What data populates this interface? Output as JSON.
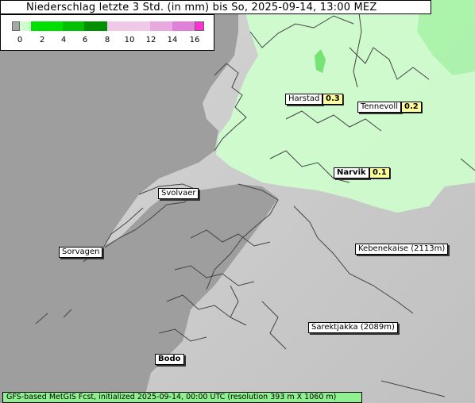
{
  "title": "Niederschlag letzte 3 Std. (in mm) bis So, 2025-09-14, 13:00 MEZ",
  "legend": {
    "ticks": [
      "0",
      "2",
      "4",
      "6",
      "8",
      "10",
      "12",
      "14",
      "16"
    ],
    "colors": [
      "#a8a8a8",
      "#cfffcf",
      "#00e000",
      "#00c000",
      "#009000",
      "#f0c8e8",
      "#e8a8e0",
      "#e080d8",
      "#ff30d0"
    ]
  },
  "places": [
    {
      "name": "Harstad",
      "bold": false
    },
    {
      "name": "Tennevoll",
      "bold": false
    },
    {
      "name": "Narvik",
      "bold": true
    },
    {
      "name": "Svolvaer",
      "bold": false
    },
    {
      "name": "Sorvagen",
      "bold": false
    },
    {
      "name": "Kebenekaise (2113m)",
      "bold": false
    },
    {
      "name": "Sarektjakka (2089m)",
      "bold": false
    },
    {
      "name": "Bodo",
      "bold": true
    }
  ],
  "values": [
    {
      "label": "0.3"
    },
    {
      "label": "0.2"
    },
    {
      "label": "0.1"
    }
  ],
  "footer": "GFS-based MetGIS Fcst, initialized 2025-09-14, 00:00 UTC  (resolution 393 m X 1060 m)"
}
